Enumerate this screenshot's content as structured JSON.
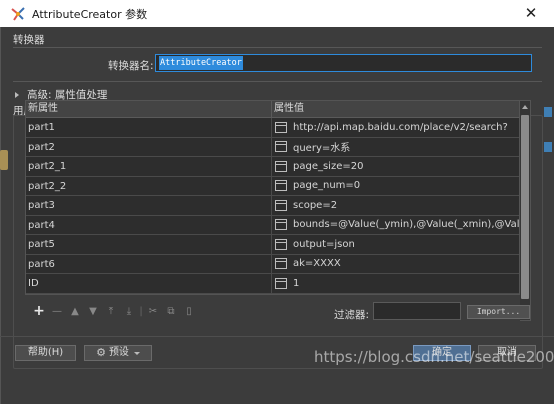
{
  "window": {
    "title": "AttributeCreator 参数",
    "close_glyph": "✕"
  },
  "transformer": {
    "section_label": "转换器",
    "name_label": "转换器名:",
    "name_value": "AttributeCreator"
  },
  "advanced": {
    "label": "高级: 属性值处理"
  },
  "create": {
    "label": "用属性来创建"
  },
  "table": {
    "headers": [
      "新属性",
      "属性值"
    ],
    "rows": [
      {
        "name": "part1",
        "value": "http://api.map.baidu.com/place/v2/search?"
      },
      {
        "name": "part2",
        "value": "query=水系"
      },
      {
        "name": "part2_1",
        "value": "page_size=20"
      },
      {
        "name": "part2_2",
        "value": "page_num=0"
      },
      {
        "name": "part3",
        "value": "scope=2"
      },
      {
        "name": "part4",
        "value": "bounds=@Value(_ymin),@Value(_xmin),@Valu..."
      },
      {
        "name": "part5",
        "value": "output=json"
      },
      {
        "name": "part6",
        "value": "ak=XXXX"
      },
      {
        "name": "ID",
        "value": "1"
      }
    ]
  },
  "toolbar": {
    "add": "+",
    "remove": "—",
    "move_up": "▲",
    "move_down": "▼",
    "move_top": "⤒",
    "move_bottom": "⤓",
    "separator": "|",
    "cut": "✂",
    "copy": "⧉",
    "paste": "▯"
  },
  "filter": {
    "label": "过滤器:",
    "value": ""
  },
  "import_button": "Import...",
  "buttons": {
    "help": "帮助(H)",
    "presets": "预设",
    "ok": "确定",
    "cancel": "取消"
  },
  "watermark": "https://blog.csdn.net/seattle2009"
}
